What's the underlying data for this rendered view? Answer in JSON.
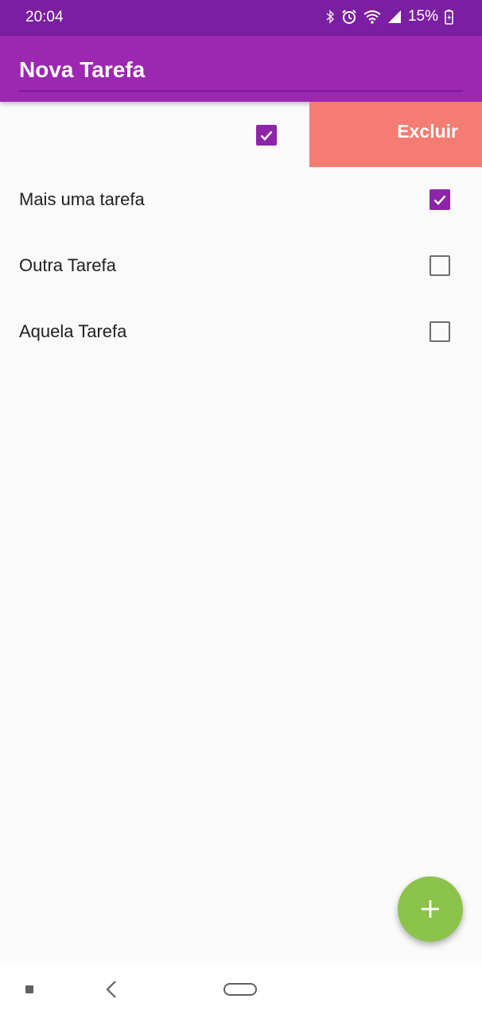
{
  "status_bar": {
    "time": "20:04",
    "battery": "15%",
    "icons": [
      "bluetooth-icon",
      "alarm-icon",
      "wifi-icon",
      "signal-icon",
      "battery-icon"
    ]
  },
  "app_bar": {
    "title_input_value": "Nova Tarefa"
  },
  "swiped_item": {
    "label": "",
    "checked": true,
    "delete_label": "Excluir"
  },
  "tasks": [
    {
      "label": "Mais uma tarefa",
      "checked": true
    },
    {
      "label": "Outra Tarefa",
      "checked": false
    },
    {
      "label": "Aquela Tarefa",
      "checked": false
    }
  ],
  "fab": {
    "icon": "plus-icon"
  },
  "nav_bar": {
    "icons": [
      "recents-icon",
      "back-icon",
      "home-icon"
    ]
  },
  "colors": {
    "status_bar": "#7b1fa2",
    "app_bar": "#9c27b0",
    "checkbox_checked": "#8e24aa",
    "delete_background": "#f47c72",
    "fab": "#8bc34a"
  }
}
